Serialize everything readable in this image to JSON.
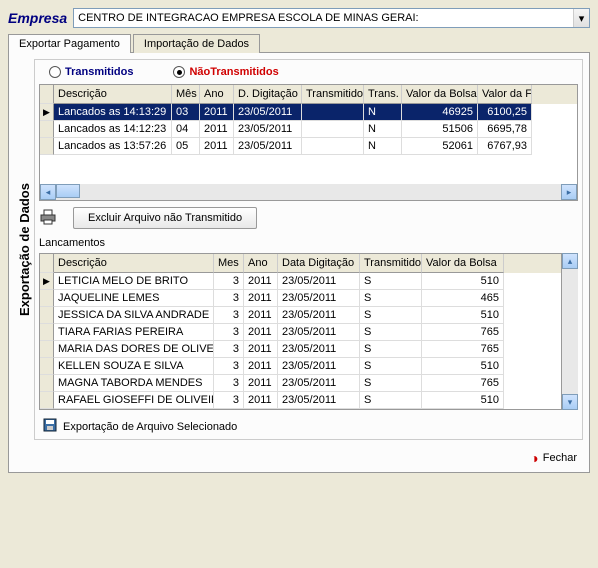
{
  "header": {
    "empresa_label": "Empresa",
    "empresa_value": "CENTRO DE INTEGRACAO EMPRESA ESCOLA DE MINAS GERAI:"
  },
  "tabs": {
    "export": "Exportar Pagamento",
    "import": "Importação de Dados"
  },
  "sidebar_label": "Exportação de Dados",
  "radios": {
    "transmitidos": "Transmitidos",
    "nao_transmitidos": "NãoTransmitidos"
  },
  "grid1": {
    "headers": {
      "descricao": "Descrição",
      "mes": "Mês",
      "ano": "Ano",
      "ddig": "D. Digitação",
      "transmitido": "Transmitido",
      "trans": "Trans.",
      "valor_bolsa": "Valor da Bolsa",
      "valor_r": "Valor da F"
    },
    "rows": [
      {
        "descricao": "Lancados as 14:13:29",
        "mes": "03",
        "ano": "2011",
        "ddig": "23/05/2011",
        "transmitido": "",
        "trans": "N",
        "valor_bolsa": "46925",
        "valor_r": "6100,25",
        "selected": true
      },
      {
        "descricao": "Lancados as 14:12:23",
        "mes": "04",
        "ano": "2011",
        "ddig": "23/05/2011",
        "transmitido": "",
        "trans": "N",
        "valor_bolsa": "51506",
        "valor_r": "6695,78"
      },
      {
        "descricao": "Lancados as 13:57:26",
        "mes": "05",
        "ano": "2011",
        "ddig": "23/05/2011",
        "transmitido": "",
        "trans": "N",
        "valor_bolsa": "52061",
        "valor_r": "6767,93"
      }
    ]
  },
  "actions": {
    "excluir": "Excluir Arquivo não Transmitido"
  },
  "section_label": "Lancamentos",
  "grid2": {
    "headers": {
      "descricao": "Descrição",
      "mes": "Mes",
      "ano": "Ano",
      "data_dig": "Data Digitação",
      "transmitido": "Transmitido",
      "valor_bolsa": "Valor da Bolsa"
    },
    "rows": [
      {
        "descricao": "LETICIA MELO DE BRITO",
        "mes": "3",
        "ano": "2011",
        "data_dig": "23/05/2011",
        "trans": "S",
        "valor": "510",
        "cur": true
      },
      {
        "descricao": "JAQUELINE LEMES",
        "mes": "3",
        "ano": "2011",
        "data_dig": "23/05/2011",
        "trans": "S",
        "valor": "465"
      },
      {
        "descricao": "JESSICA DA SILVA ANDRADE N",
        "mes": "3",
        "ano": "2011",
        "data_dig": "23/05/2011",
        "trans": "S",
        "valor": "510"
      },
      {
        "descricao": "TIARA FARIAS PEREIRA",
        "mes": "3",
        "ano": "2011",
        "data_dig": "23/05/2011",
        "trans": "S",
        "valor": "765"
      },
      {
        "descricao": "MARIA DAS DORES DE OLIVEIF",
        "mes": "3",
        "ano": "2011",
        "data_dig": "23/05/2011",
        "trans": "S",
        "valor": "765"
      },
      {
        "descricao": "KELLEN SOUZA E SILVA",
        "mes": "3",
        "ano": "2011",
        "data_dig": "23/05/2011",
        "trans": "S",
        "valor": "510"
      },
      {
        "descricao": "MAGNA TABORDA MENDES",
        "mes": "3",
        "ano": "2011",
        "data_dig": "23/05/2011",
        "trans": "S",
        "valor": "765"
      },
      {
        "descricao": "RAFAEL GIOSEFFI DE OLIVEIR/",
        "mes": "3",
        "ano": "2011",
        "data_dig": "23/05/2011",
        "trans": "S",
        "valor": "510"
      }
    ]
  },
  "footer": {
    "export_sel": "Exportação de Arquivo Selecionado"
  },
  "close": "Fechar"
}
